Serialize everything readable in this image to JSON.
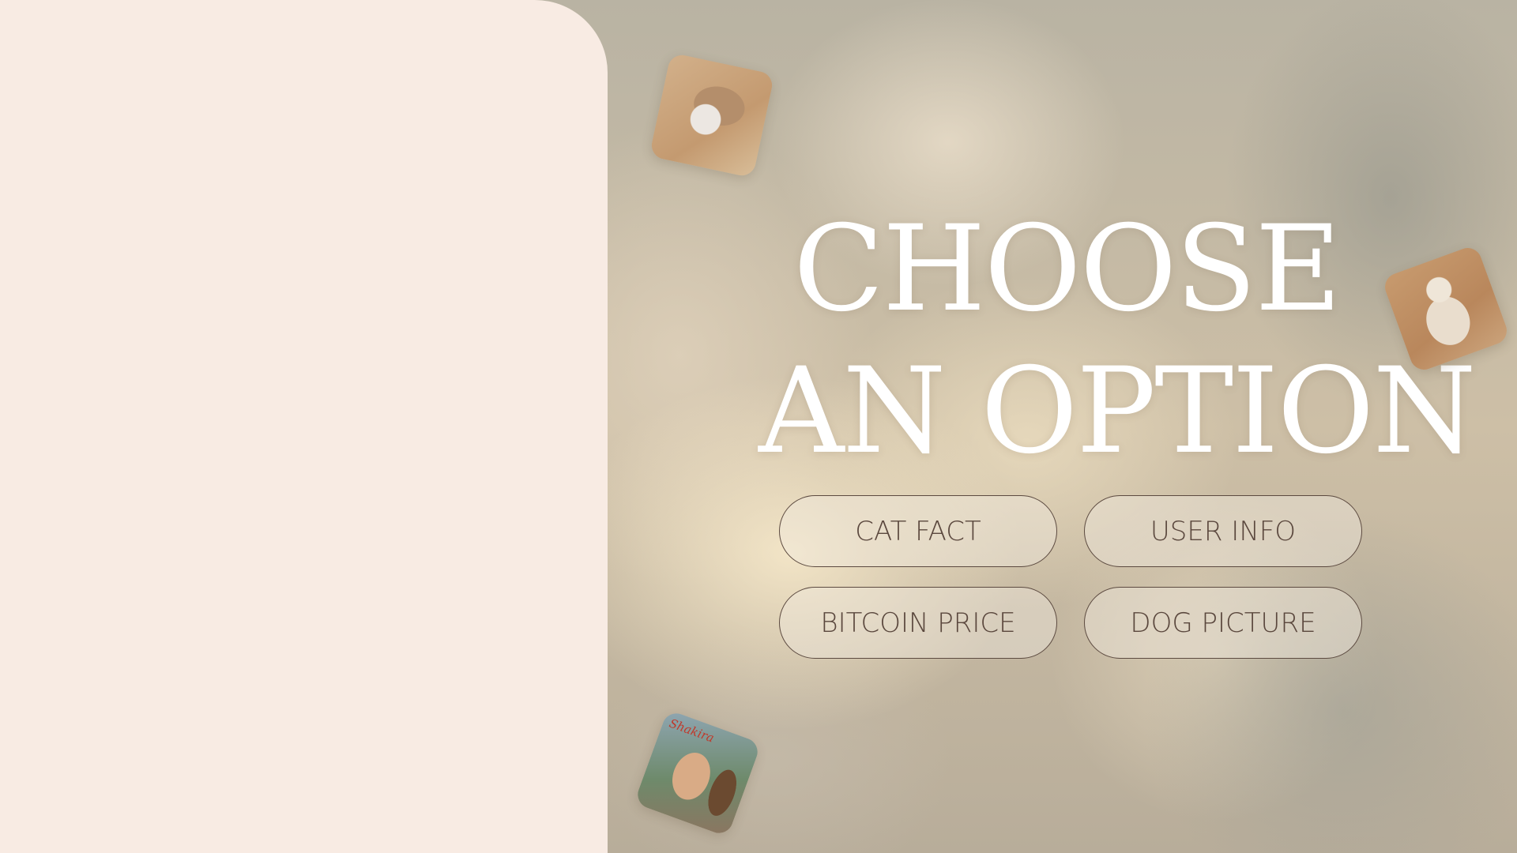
{
  "headline": {
    "line1": "CHOOSE",
    "line2": "AN OPTION"
  },
  "options": {
    "cat_fact": "CAT FACT",
    "user_info": "USER INFO",
    "bitcoin_price": "BITCOIN PRICE",
    "dog_picture": "DOG PICTURE"
  },
  "albums": {
    "shakira_title": "Shakira"
  },
  "colors": {
    "panel": "#f8ebe3",
    "button_border": "#5c4a40",
    "button_text": "#5a473d",
    "headline_text": "#ffffff"
  }
}
